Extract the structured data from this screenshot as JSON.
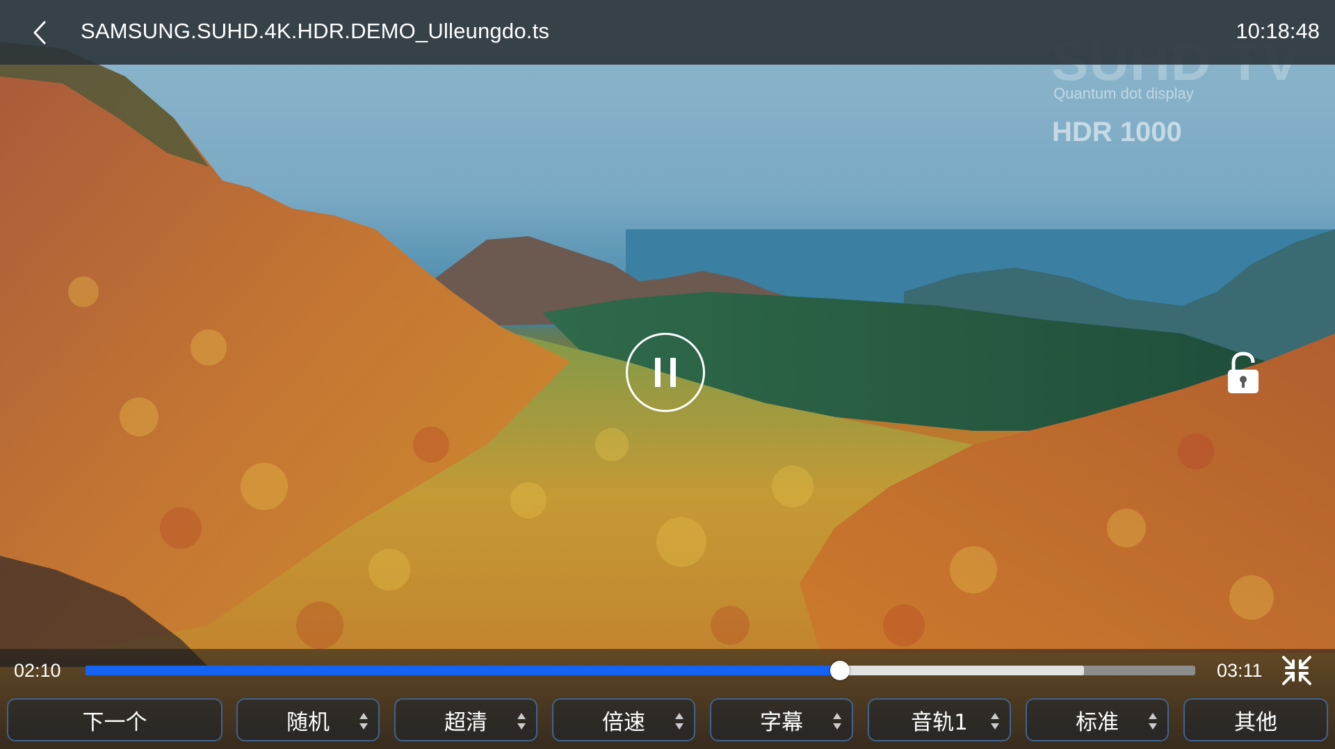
{
  "topbar": {
    "back_icon": "chevron-left-icon",
    "file_title": "SAMSUNG.SUHD.4K.HDR.DEMO_Ulleungdo.ts",
    "clock": "10:18:48"
  },
  "watermark": {
    "brand": "SUHD TV",
    "tagline": "Quantum dot display",
    "hdr": "HDR 1000"
  },
  "center": {
    "pause_icon": "pause-icon",
    "lock_icon": "unlock-icon"
  },
  "playback": {
    "current_time": "02:10",
    "total_time": "03:11",
    "progress": 0.68,
    "buffered": 0.9,
    "collapse_icon": "exit-fullscreen-icon"
  },
  "controls": [
    {
      "label": "下一个",
      "has_arrows": false
    },
    {
      "label": "随机",
      "has_arrows": true
    },
    {
      "label": "超清",
      "has_arrows": true
    },
    {
      "label": "倍速",
      "has_arrows": true
    },
    {
      "label": "字幕",
      "has_arrows": true
    },
    {
      "label": "音轨1",
      "has_arrows": true
    },
    {
      "label": "标准",
      "has_arrows": true
    },
    {
      "label": "其他",
      "has_arrows": false
    }
  ],
  "colors": {
    "accent": "#1463f2",
    "button_border": "#3f6490",
    "topbar": "#2c343a"
  }
}
